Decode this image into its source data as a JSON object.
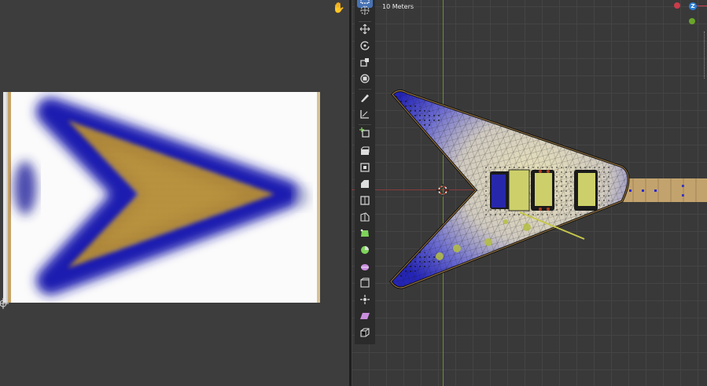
{
  "viewport": {
    "header_text": "·· ·· ··  ····",
    "scale_label": "10 Meters",
    "gizmo": {
      "z_label": "Z"
    }
  },
  "colors": {
    "editor_bg": "#3d3d3d",
    "viewport_bg": "#393939",
    "x_axis": "#8a3a3a",
    "y_axis": "#6c8f2a",
    "active_tool": "#4772b3",
    "mask_blue": "#1f1fb0",
    "wood_gold": "#c49a3a"
  },
  "toolbar": {
    "tools": [
      {
        "name": "select-box",
        "icon": "select-box-icon",
        "active": true
      },
      {
        "name": "cursor",
        "icon": "cursor-icon",
        "active": false
      },
      {
        "name": "move",
        "icon": "move-icon",
        "active": false
      },
      {
        "name": "rotate",
        "icon": "rotate-icon",
        "active": false
      },
      {
        "name": "scale",
        "icon": "scale-icon",
        "active": false
      },
      {
        "name": "transform",
        "icon": "transform-icon",
        "active": false
      },
      {
        "name": "annotate",
        "icon": "annotate-icon",
        "active": false
      },
      {
        "name": "measure",
        "icon": "measure-icon",
        "active": false
      },
      {
        "name": "add-cube",
        "icon": "add-cube-icon",
        "active": false
      },
      {
        "name": "extrude",
        "icon": "extrude-icon",
        "active": false
      },
      {
        "name": "inset",
        "icon": "inset-icon",
        "active": false
      },
      {
        "name": "bevel",
        "icon": "bevel-icon",
        "active": false
      },
      {
        "name": "loop-cut",
        "icon": "loop-cut-icon",
        "active": false
      },
      {
        "name": "knife",
        "icon": "knife-icon",
        "active": false
      },
      {
        "name": "poly-build",
        "icon": "poly-build-icon",
        "active": false
      },
      {
        "name": "spin",
        "icon": "spin-icon",
        "active": false
      },
      {
        "name": "smooth",
        "icon": "smooth-icon",
        "active": false
      },
      {
        "name": "edge-slide",
        "icon": "edge-slide-icon",
        "active": false
      },
      {
        "name": "shrink-fatten",
        "icon": "shrink-fatten-icon",
        "active": false
      },
      {
        "name": "shear",
        "icon": "shear-icon",
        "active": false
      },
      {
        "name": "rip-region",
        "icon": "rip-region-icon",
        "active": false
      }
    ]
  }
}
